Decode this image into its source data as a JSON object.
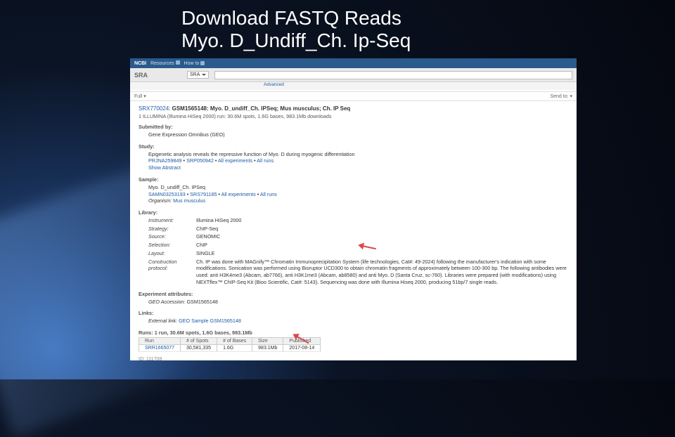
{
  "slideTitle1": "Download FASTQ Reads",
  "slideTitle2": "Myo. D_Undiff_Ch. Ip-Seq",
  "ncbi": {
    "logo": "NCBI",
    "resources": "Resources",
    "how": "How to"
  },
  "sra": {
    "brand": "SRA",
    "selector": "SRA",
    "advanced": "Advanced"
  },
  "toolbar": {
    "left": "Full ▾",
    "right": "Send to: ▾"
  },
  "title": {
    "srx": "SRX770024",
    "gsm": "GSM1565148: Myo. D_undiff_Ch. IPSeq; Mus musculus; Ch. IP Seq",
    "sub": "1 ILLUMINA (Illumina HiSeq 2000) run: 30.6M spots, 1.6G bases, 983.1Mb downloads"
  },
  "submitted": {
    "h": "Submitted by:",
    "v": "Gene Expression Omnibus (GEO)"
  },
  "study": {
    "h": "Study:",
    "desc": "Epigenetic analysis reveals the repressive function of Myo. D during myogenic differentiation",
    "prjna": "PRJNA259849",
    "srp": "SRP050942",
    "allexp": "All experiments",
    "allruns": "All runs",
    "abstract": "Show Abstract"
  },
  "sample": {
    "h": "Sample:",
    "name": "Myo. D_undiff_Ch. IPSeq",
    "samn": "SAMN03253193",
    "srs": "SRS791185",
    "allexp": "All experiments",
    "allruns": "All runs",
    "orgk": "Organism:",
    "orgv": "Mus musculus"
  },
  "library": {
    "h": "Library:",
    "instrk": "Instrument:",
    "instrv": "Illumina HiSeq 2000",
    "stratk": "Strategy:",
    "stratv": "ChIP-Seq",
    "srck": "Source:",
    "srcv": "GENOMIC",
    "selk": "Selection:",
    "selv": "ChIP",
    "layk": "Layout:",
    "layv": "SINGLE",
    "protk": "Construction protocol:",
    "protv": "Ch. IP was done with MAGnify™ Chromatin Immunoprecipitation System (life technologies, Cat#: 49-2024) following the manufacturer's indication with some modifications. Sonication was performed using Bioruptor UCD300 to obtain chromatin fragments of approximately between 100-300 bp. The following antibodies were used: anti H3K4me3 (Abcam, ab7766), anti H3K1me3 (Abcam, ab8580) and anti Myo. D (Santa Cruz, sc-760). Libraries were prepared (with modifications) using NEXTflex™ ChIP-Seq Kit (Bioo Scientific, Cat#: 5143). Sequencing was done with Illumina Hiseq 2000, producing 51bp/7 single reads."
  },
  "expattr": {
    "h": "Experiment attributes:",
    "k": "GEO Accession:",
    "v": "GSM1565148"
  },
  "links": {
    "h": "Links:",
    "k": "External link:",
    "v": "GEO Sample GSM1565148"
  },
  "runs": {
    "summary": "Runs: 1 run, 30.6M spots, 1.6G bases, 983.1Mb",
    "th": {
      "run": "Run",
      "spots": "# of Spots",
      "bases": "# of Bases",
      "size": "Size",
      "pub": "Published"
    },
    "row": {
      "run": "SRR1665077",
      "spots": "30,581,335",
      "bases": "1.6G",
      "size": "983.1Mb",
      "pub": "2017-08-14"
    }
  },
  "id": "ID: 111708"
}
